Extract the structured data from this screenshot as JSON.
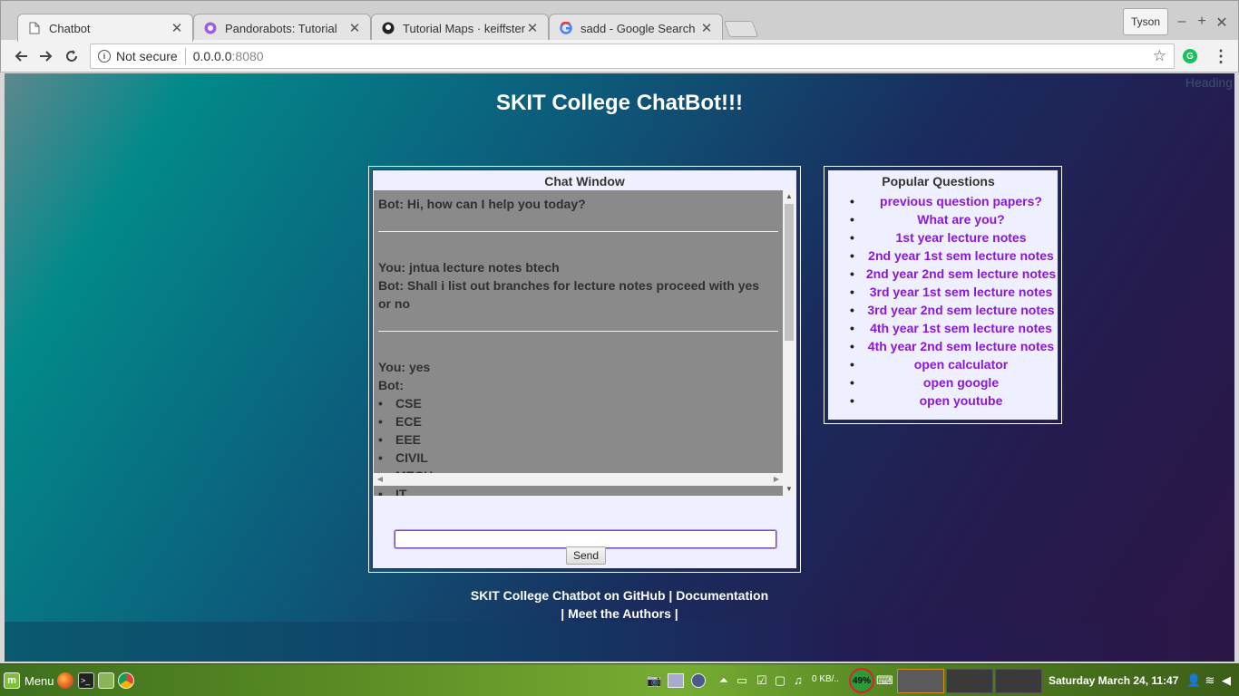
{
  "browser": {
    "tabs": [
      {
        "title": "Chatbot",
        "active": true,
        "icon": "page-icon"
      },
      {
        "title": "Pandorabots: Tutorial",
        "active": false,
        "icon": "pandorabots-icon"
      },
      {
        "title": "Tutorial Maps · keiffster",
        "active": false,
        "icon": "github-icon"
      },
      {
        "title": "sadd - Google Search",
        "active": false,
        "icon": "google-icon"
      }
    ],
    "profile_name": "Tyson",
    "address": {
      "security": "Not secure",
      "host": "0.0.0.0",
      "port": ":8080"
    }
  },
  "page": {
    "corner_text": "Heading",
    "title": "SKIT College ChatBot!!!",
    "chat": {
      "title": "Chat Window",
      "messages": {
        "m1": "Bot: Hi, how can I help you today?",
        "m2": "You: jntua lecture notes btech",
        "m3": "Bot: Shall i list out branches for lecture notes proceed with yes or no",
        "m4": "You: yes",
        "m5": "Bot:",
        "branches": [
          "CSE",
          "ECE",
          "EEE",
          "CIVIL",
          "MECH",
          "IT"
        ]
      },
      "input_value": "",
      "send_label": "Send"
    },
    "popular": {
      "title": "Popular Questions",
      "items": [
        "previous question papers?",
        "What are you?",
        "1st year lecture notes",
        "2nd year 1st sem lecture notes",
        "2nd year 2nd sem lecture notes",
        "3rd year 1st sem lecture notes",
        "3rd year 2nd sem lecture notes",
        "4th year 1st sem lecture notes",
        "4th year 2nd sem lecture notes",
        "open calculator",
        "open google",
        "open youtube"
      ]
    },
    "footer": {
      "github": "SKIT College Chatbot on GitHub",
      "sep1": " | ",
      "docs": "Documentation",
      "lead": "| ",
      "authors": "Meet the Authors",
      "trail": " |"
    }
  },
  "taskbar": {
    "menu_label": "Menu",
    "network_speed": "0 KB/..",
    "battery": "49%",
    "clock": "Saturday March 24, 11:47"
  },
  "colors": {
    "link_purple": "#8a19d4",
    "panel_bg": "#eef0ff",
    "chat_log_bg": "#8a8a8a"
  }
}
